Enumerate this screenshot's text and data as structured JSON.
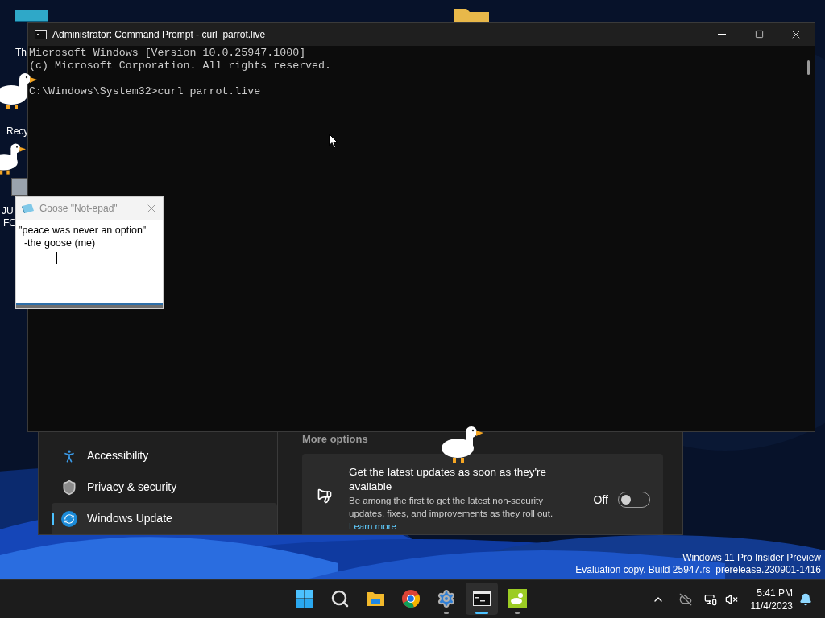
{
  "desktop_icons": [
    {
      "label": "Th"
    },
    {
      "label": "Recy"
    },
    {
      "label": "JU"
    },
    {
      "label": "FO"
    }
  ],
  "settings": {
    "nav": [
      {
        "label": "Accessibility",
        "kind": "accessibility",
        "selected": false
      },
      {
        "label": "Privacy & security",
        "kind": "shield",
        "selected": false
      },
      {
        "label": "Windows Update",
        "kind": "update",
        "selected": true
      }
    ],
    "section_title": "More options",
    "option": {
      "title": "Get the latest updates as soon as they're available",
      "description": "Be among the first to get the latest non-security updates, fixes, and improvements as they roll out.",
      "link": "Learn more",
      "state_label": "Off",
      "on": false
    }
  },
  "cmd": {
    "title": "Administrator: Command Prompt - curl  parrot.live",
    "banner": [
      "Microsoft Windows [Version 10.0.25947.1000]",
      "(c) Microsoft Corporation. All rights reserved."
    ],
    "prompt": "C:\\Windows\\System32>curl parrot.live"
  },
  "notepad": {
    "title": "Goose \"Not-epad\"",
    "lines": [
      "\"peace was never an option\"",
      "  -the goose (me)"
    ]
  },
  "watermark": [
    "Windows 11 Pro Insider Preview",
    "Evaluation copy. Build 25947.rs_prerelease.230901-1416"
  ],
  "taskbar": {
    "apps": [
      {
        "kind": "start",
        "running": false,
        "active": false
      },
      {
        "kind": "search",
        "running": false,
        "active": false
      },
      {
        "kind": "explorer",
        "running": false,
        "active": false
      },
      {
        "kind": "chrome",
        "running": false,
        "active": false
      },
      {
        "kind": "settings",
        "running": true,
        "active": false
      },
      {
        "kind": "terminal",
        "running": true,
        "active": true
      },
      {
        "kind": "goose",
        "running": true,
        "active": false
      }
    ],
    "time": "5:41 PM",
    "date": "11/4/2023"
  }
}
